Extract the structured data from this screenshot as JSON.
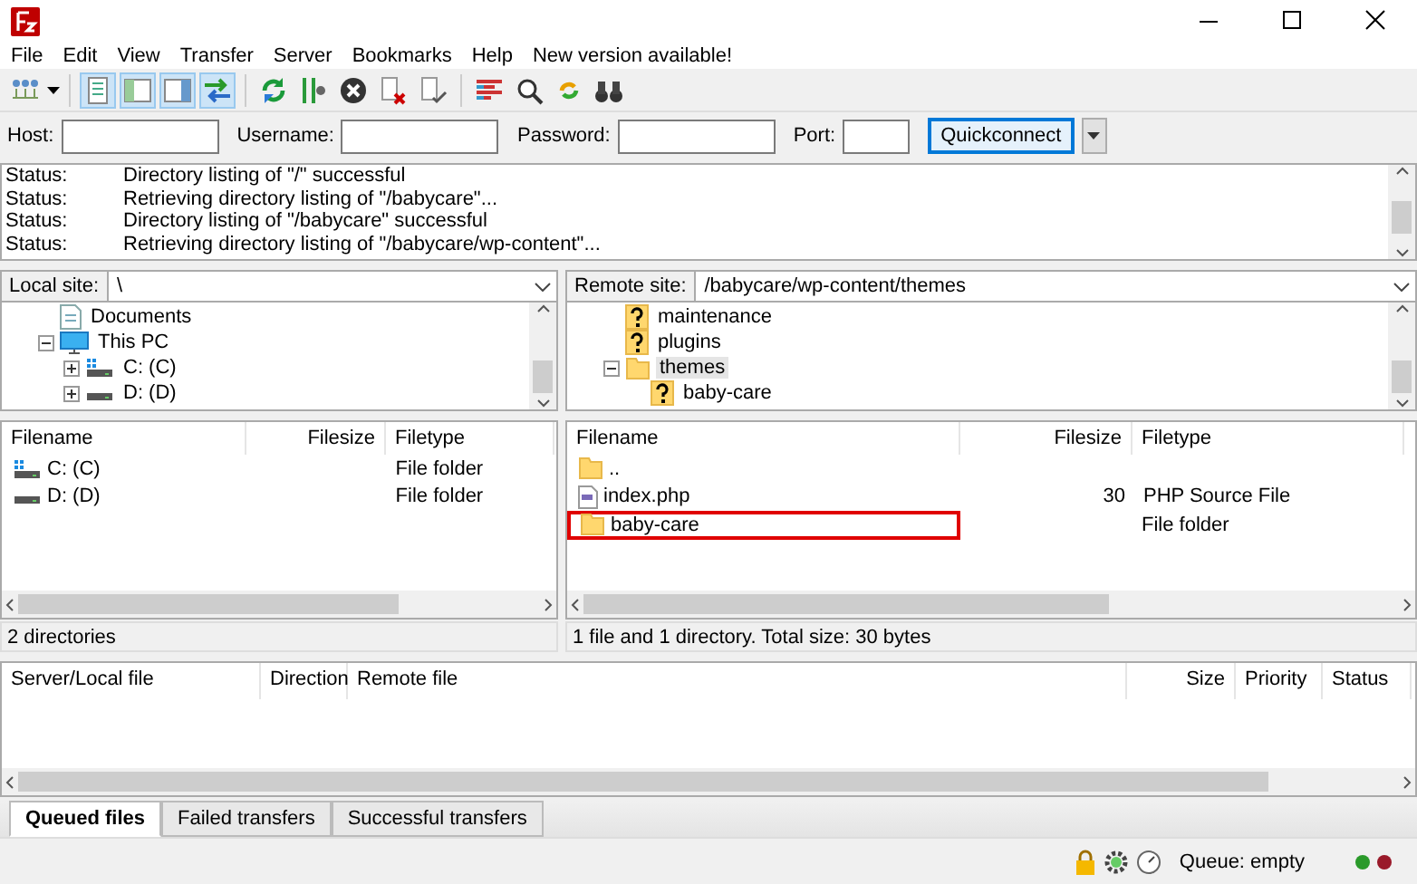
{
  "menu": [
    "File",
    "Edit",
    "View",
    "Transfer",
    "Server",
    "Bookmarks",
    "Help",
    "New version available!"
  ],
  "toolbar": {
    "toggles": [
      {
        "on": true
      },
      {
        "on": true
      },
      {
        "on": true
      },
      {
        "on": true
      }
    ]
  },
  "quickconnect": {
    "fields": [
      {
        "label": "Host:",
        "kind": "wide"
      },
      {
        "label": "Username:",
        "kind": "wide"
      },
      {
        "label": "Password:",
        "kind": "wide"
      },
      {
        "label": "Port:",
        "kind": "narrow"
      }
    ],
    "button": "Quickconnect"
  },
  "log": [
    {
      "label": "Status:",
      "message": "Directory listing of \"/\" successful"
    },
    {
      "label": "Status:",
      "message": "Retrieving directory listing of \"/babycare\"..."
    },
    {
      "label": "Status:",
      "message": "Directory listing of \"/babycare\" successful"
    },
    {
      "label": "Status:",
      "message": "Retrieving directory listing of \"/babycare/wp-content\"..."
    }
  ],
  "local": {
    "site_label": "Local site:",
    "path": "\\",
    "tree": [
      {
        "label": "Documents",
        "kind": "document",
        "selected": false
      },
      {
        "label": "This PC",
        "kind": "computer",
        "selected": false,
        "expanded": true,
        "children": [
          {
            "label": "C: (C)",
            "kind": "system-drive",
            "selected": false,
            "expanded": false
          },
          {
            "label": "D: (D)",
            "kind": "drive",
            "selected": false,
            "expanded": false
          }
        ]
      }
    ],
    "columns": [
      "Filename",
      "Filesize",
      "Filetype"
    ],
    "rows": [
      {
        "name": "C: (C)",
        "kind": "system-drive",
        "size": "",
        "type": "File folder",
        "outlined": false
      },
      {
        "name": "D: (D)",
        "kind": "drive",
        "size": "",
        "type": "File folder",
        "outlined": false
      }
    ],
    "summary": "2 directories"
  },
  "remote": {
    "site_label": "Remote site:",
    "path": "/babycare/wp-content/themes",
    "tree": [
      {
        "label": "maintenance",
        "kind": "unknown",
        "selected": false
      },
      {
        "label": "plugins",
        "kind": "unknown",
        "selected": false
      },
      {
        "label": "themes",
        "kind": "folder",
        "selected": true,
        "expanded": true,
        "children": [
          {
            "label": "baby-care",
            "kind": "unknown",
            "selected": false
          }
        ]
      }
    ],
    "columns": [
      "Filename",
      "Filesize",
      "Filetype"
    ],
    "rows": [
      {
        "name": "..",
        "kind": "folder",
        "size": "",
        "type": "",
        "outlined": false
      },
      {
        "name": "index.php",
        "kind": "php",
        "size": "30",
        "type": "PHP Source File",
        "outlined": false
      },
      {
        "name": "baby-care",
        "kind": "folder",
        "size": "",
        "type": "File folder",
        "outlined": true
      }
    ],
    "summary": "1 file and 1 directory. Total size: 30 bytes"
  },
  "queue": {
    "columns": [
      "Server/Local file",
      "Direction",
      "Remote file",
      "Size",
      "Priority",
      "Status"
    ],
    "tabs": [
      {
        "label": "Queued files",
        "selected": true
      },
      {
        "label": "Failed transfers",
        "selected": false
      },
      {
        "label": "Successful transfers",
        "selected": false
      }
    ]
  },
  "status_bar": {
    "queue": "Queue: empty"
  }
}
